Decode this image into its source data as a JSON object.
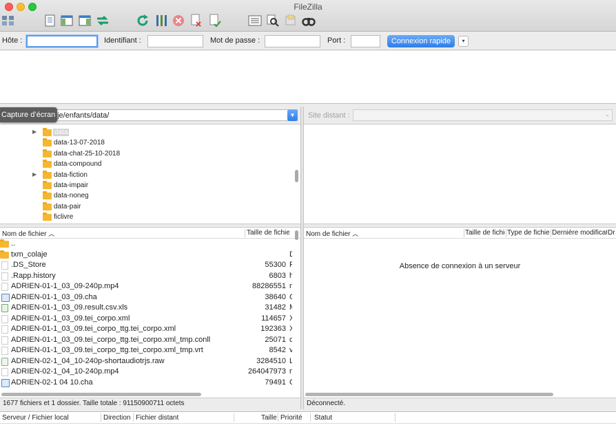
{
  "window": {
    "title": "FileZilla"
  },
  "toolbar": {
    "icons": [
      "site-manager-icon",
      "toggle-log-icon",
      "toggle-local-tree-icon",
      "toggle-remote-tree-icon",
      "transfer-queue-icon",
      "refresh-icon",
      "process-queue-icon",
      "cancel-icon",
      "disconnect-icon",
      "reconnect-icon",
      "directory-listing-filters-icon",
      "compare-directories-icon",
      "synchronized-browsing-icon",
      "search-icon"
    ]
  },
  "quickconnect": {
    "host_label": "Hôte :",
    "host_value": "",
    "user_label": "Identifiant :",
    "user_value": "",
    "password_label": "Mot de passe :",
    "password_value": "",
    "port_label": "Port :",
    "port_value": "",
    "connect_button": "Connexion rapide",
    "dropdown": "▾"
  },
  "local": {
    "path": "aje/enfants/data/",
    "tooltip": "Capture d’écran",
    "tree": [
      {
        "label": "data",
        "expandable": true,
        "selected": true
      },
      {
        "label": "data-13-07-2018",
        "expandable": false
      },
      {
        "label": "data-chat-25-10-2018",
        "expandable": false
      },
      {
        "label": "data-compound",
        "expandable": false
      },
      {
        "label": "data-fiction",
        "expandable": true
      },
      {
        "label": "data-impair",
        "expandable": false
      },
      {
        "label": "data-noneg",
        "expandable": false
      },
      {
        "label": "data-pair",
        "expandable": false
      },
      {
        "label": "ficlivre",
        "expandable": false
      }
    ],
    "columns": {
      "name": "Nom de fichier",
      "size": "Taille de fichier"
    },
    "files": [
      {
        "name": "..",
        "size": "",
        "type": "",
        "icon": "folder"
      },
      {
        "name": "txm_colaje",
        "size": "",
        "type": "D",
        "icon": "folder"
      },
      {
        "name": ".DS_Store",
        "size": "55300",
        "type": "F",
        "icon": "file"
      },
      {
        "name": ".Rapp.history",
        "size": "6803",
        "type": "h",
        "icon": "file"
      },
      {
        "name": "ADRIEN-01-1_03_09-240p.mp4",
        "size": "88286551",
        "type": "m",
        "icon": "file"
      },
      {
        "name": "ADRIEN-01-1_03_09.cha",
        "size": "38640",
        "type": "C",
        "icon": "cha"
      },
      {
        "name": "ADRIEN-01-1_03_09.result.csv.xls",
        "size": "31482",
        "type": "M",
        "icon": "xls"
      },
      {
        "name": "ADRIEN-01-1_03_09.tei_corpo.xml",
        "size": "114657",
        "type": "X",
        "icon": "file"
      },
      {
        "name": "ADRIEN-01-1_03_09.tei_corpo_ttg.tei_corpo.xml",
        "size": "192363",
        "type": "X",
        "icon": "file"
      },
      {
        "name": "ADRIEN-01-1_03_09.tei_corpo_ttg.tei_corpo.xml_tmp.conll",
        "size": "25071",
        "type": "c",
        "icon": "file"
      },
      {
        "name": "ADRIEN-01-1_03_09.tei_corpo_ttg.tei_corpo.xml_tmp.vrt",
        "size": "8542",
        "type": "v",
        "icon": "file"
      },
      {
        "name": "ADRIEN-02-1_04_10-240p-shortaudiotrjs.raw",
        "size": "3284510",
        "type": "L",
        "icon": "media"
      },
      {
        "name": "ADRIEN-02-1_04_10-240p.mp4",
        "size": "264047973",
        "type": "m",
        "icon": "file"
      },
      {
        "name": "ADRIEN-02-1 04 10.cha",
        "size": "79491",
        "type": "C",
        "icon": "cha"
      }
    ],
    "status": "1677 fichiers et 1 dossier. Taille totale : 91150900711 octets"
  },
  "remote": {
    "site_label": "Site distant :",
    "columns": {
      "name": "Nom de fichier",
      "size": "Taille de fichie",
      "type": "Type de fichier",
      "modified": "Dernière modificat",
      "rights": "Dr"
    },
    "empty_message": "Absence de connexion à un serveur",
    "status": "Déconnecté."
  },
  "queue": {
    "columns": {
      "server": "Serveur / Fichier local",
      "direction": "Direction",
      "remote": "Fichier distant",
      "size": "Taille",
      "priority": "Priorité",
      "status": "Statut"
    }
  },
  "colors": {
    "accent": "#2f7de9",
    "folder": "#f5b731",
    "close": "#fd5f57",
    "minimize": "#febc2e",
    "zoom": "#28c840"
  }
}
